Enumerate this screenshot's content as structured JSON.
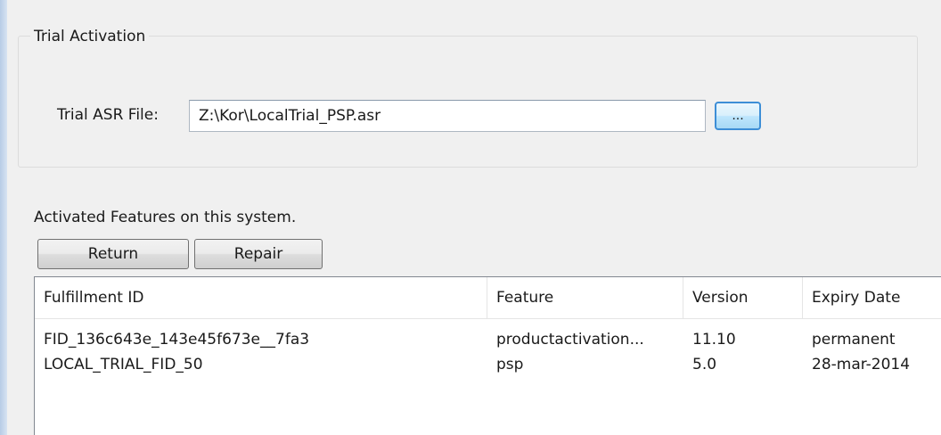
{
  "trial_activation": {
    "group_title": "Trial Activation",
    "file_label": "Trial ASR File:",
    "file_value": "Z:\\Kor\\LocalTrial_PSP.asr",
    "browse_label": "..."
  },
  "activated": {
    "section_label": "Activated Features on this system.",
    "return_label": "Return",
    "repair_label": "Repair",
    "columns": [
      "Fulfillment ID",
      "Feature",
      "Version",
      "Expiry Date"
    ],
    "rows": [
      {
        "fulfillment_id": "FID_136c643e_143e45f673e__7fa3",
        "feature": "productactivation...",
        "version": "11.10",
        "expiry": "permanent"
      },
      {
        "fulfillment_id": "LOCAL_TRIAL_FID_50",
        "feature": "psp",
        "version": "5.0",
        "expiry": "28-mar-2014"
      }
    ]
  },
  "colors": {
    "panel_background": "#f0f0f0",
    "focus_border": "#3d8ed6",
    "list_border": "#828790"
  }
}
